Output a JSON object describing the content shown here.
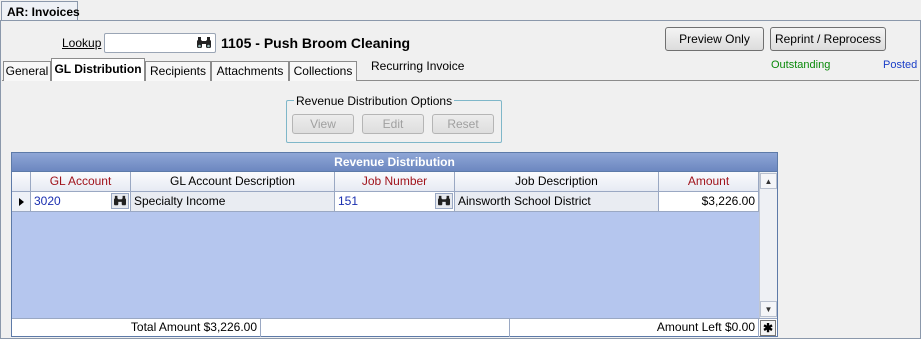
{
  "window": {
    "doc_tab": "AR: Invoices"
  },
  "lookup": {
    "label": "Lookup",
    "value": "",
    "icon": "binoculars-icon"
  },
  "record": {
    "title": "1105 - Push Broom Cleaning"
  },
  "buttons": {
    "preview": "Preview Only",
    "reprint": "Reprint / Reprocess"
  },
  "tabs": [
    {
      "label": "General",
      "active": false
    },
    {
      "label": "GL Distribution",
      "active": true
    },
    {
      "label": "Recipients",
      "active": false
    },
    {
      "label": "Attachments",
      "active": false
    },
    {
      "label": "Collections",
      "active": false
    }
  ],
  "recurring_label": "Recurring Invoice",
  "status": {
    "outstanding": "Outstanding",
    "outstanding_color": "#0a8a0a",
    "posted": "Posted",
    "posted_color": "#1a3ec7"
  },
  "revenue_options": {
    "title": "Revenue Distribution Options",
    "buttons": [
      "View",
      "Edit",
      "Reset"
    ]
  },
  "grid": {
    "title": "Revenue Distribution",
    "columns": [
      "GL Account",
      "GL Account Description",
      "Job Number",
      "Job Description",
      "Amount"
    ],
    "rows": [
      {
        "gl_account": "3020",
        "gl_description": "Specialty Income",
        "job_number": "151",
        "job_description": "Ainsworth School District",
        "amount": "$3,226.00"
      }
    ],
    "footer": {
      "total": "Total Amount $3,226.00",
      "middle": "",
      "left": "Amount Left $0.00",
      "add": "✱"
    },
    "header_bg": "#7891c9",
    "body_bg": "#b5c6ee"
  }
}
